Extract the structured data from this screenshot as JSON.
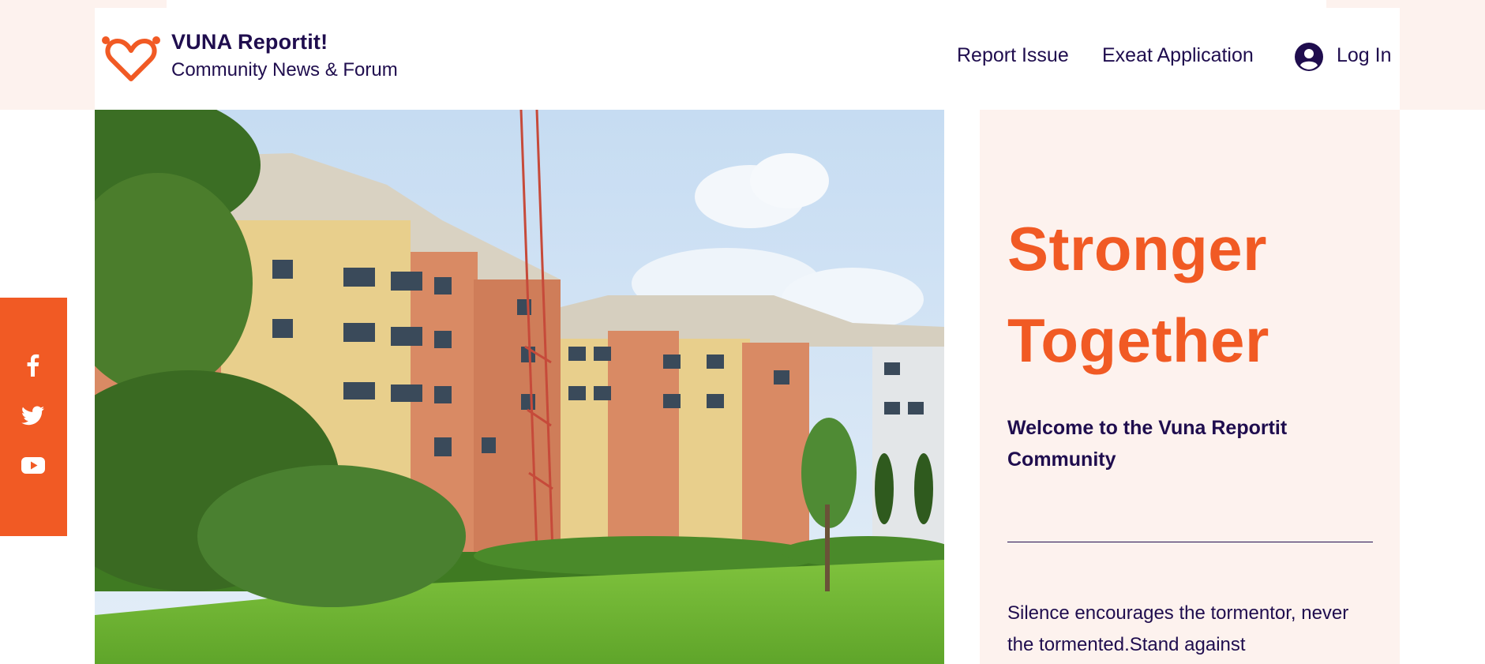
{
  "header": {
    "site_title": "VUNA Reportit!",
    "site_tagline": "Community News & Forum",
    "nav": [
      {
        "label": "Report Issue"
      },
      {
        "label": "Exeat Application"
      }
    ],
    "login_label": "Log In",
    "logo_icon": "heart-icon",
    "avatar_icon": "user-avatar-icon"
  },
  "hero": {
    "image_subject": "campus-buildings-photo",
    "headline_line1": "Stronger",
    "headline_line2": "Together",
    "welcome": "Welcome to the Vuna Reportit Community",
    "body_text": "Silence encourages the tormentor, never the tormented.Stand against"
  },
  "social": [
    {
      "icon": "facebook-icon"
    },
    {
      "icon": "twitter-icon"
    },
    {
      "icon": "youtube-icon"
    }
  ],
  "colors": {
    "accent": "#f15a24",
    "text": "#1f0d4e",
    "panel_bg": "#fdf2ee"
  }
}
